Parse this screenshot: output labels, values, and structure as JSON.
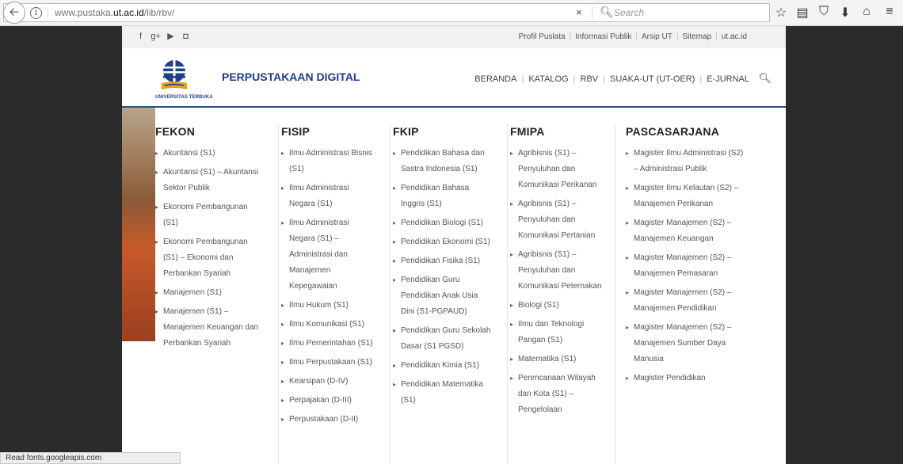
{
  "browser": {
    "url_prefix": "www.pustaka.",
    "url_domain": "ut.ac.id",
    "url_path": "/lib/rbv/",
    "search_placeholder": "Search",
    "status_text": "Read fonts.googleapis.com"
  },
  "topbar": {
    "links": [
      "Profil Puslata",
      "Informasi Publik",
      "Arsip UT",
      "Sitemap",
      "ut.ac.id"
    ]
  },
  "header": {
    "site_title": "PERPUSTAKAAN DIGITAL",
    "logo_caption": "UNIVERSITAS TERBUKA",
    "nav": [
      "BERANDA",
      "KATALOG",
      "RBV",
      "SUAKA-UT (UT-OER)",
      "E-JURNAL"
    ]
  },
  "menu": {
    "columns": [
      {
        "title": "FEKON",
        "items": [
          "Akuntansi (S1)",
          "Akuntansi (S1) – Akuntansi Sektor Publik",
          "Ekonomi Pembangunan (S1)",
          "Ekonomi Pembangunan (S1) – Ekonomi dan Perbankan Syariah",
          "Manajemen (S1)",
          "Manajemen (S1) – Manajemen Keuangan dan Perbankan Syariah"
        ]
      },
      {
        "title": "FISIP",
        "items": [
          "Ilmu Administrasi Bisnis (S1)",
          "Ilmu Administrasi Negara (S1)",
          "Ilmu Administrasi Negara (S1) – Administrasi dan Manajemen Kepegawaian",
          "Ilmu Hukum (S1)",
          "Ilmu Komunikasi (S1)",
          "Ilmu Pemerintahan (S1)",
          "Ilmu Perpustakaan (S1)",
          "Kearsipan (D-IV)",
          "Perpajakan (D-III)",
          "Perpustakaan (D-II)"
        ]
      },
      {
        "title": "FKIP",
        "items": [
          "Pendidikan Bahasa dan Sastra Indonesia (S1)",
          "Pendidikan Bahasa Inggris (S1)",
          "Pendidikan Biologi (S1)",
          "Pendidikan Ekonomi (S1)",
          "Pendidikan Fisika (S1)",
          "Pendidikan Guru Pendidikan Anak Usia Dini (S1-PGPAUD)",
          "Pendidikan Guru Sekolah Dasar (S1 PGSD)",
          "Pendidikan Kimia (S1)",
          "Pendidikan Matematika (S1)"
        ]
      },
      {
        "title": "FMIPA",
        "items": [
          "Agribisnis (S1) – Penyuluhan dan Komunikasi Perikanan",
          "Agribisnis (S1) – Penyuluhan dan Komunikasi Pertanian",
          "Agribisnis (S1) – Penyuluhan dan Komunikasi Peternakan",
          "Biologi (S1)",
          "Ilmu dan Teknologi Pangan (S1)",
          "Matematika (S1)",
          "Perencanaan Wilayah dan Kota (S1) – Pengelolaan"
        ]
      },
      {
        "title": "PASCASARJANA",
        "items": [
          "Magister Ilmu Administrasi (S2) – Administrasi Publik",
          "Magister Ilmu Kelautan (S2) – Manajemen Perikanan",
          "Magister Manajemen (S2) – Manajemen Keuangan",
          "Magister Manajemen (S2) – Manajemen Pemasaran",
          "Magister Manajemen (S2) – Manajemen Pendidikan",
          "Magister Manajemen (S2) – Manajemen Sumber Daya Manusia",
          "Magister Pendidikan"
        ]
      }
    ]
  },
  "colors": {
    "brand": "#1e3f8a",
    "accent": "#c07a2a"
  }
}
